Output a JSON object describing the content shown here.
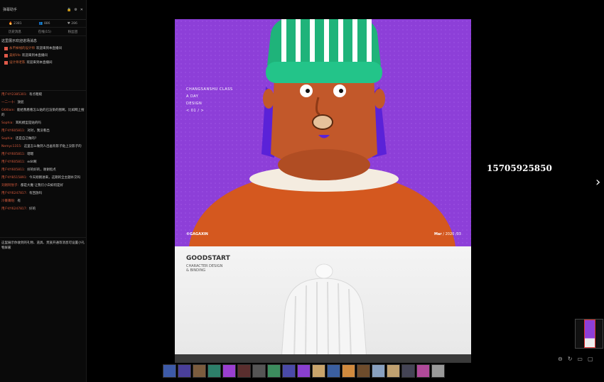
{
  "panel": {
    "title": "弹幕助手",
    "stats": [
      {
        "icon": "flame-icon",
        "value": "2381"
      },
      {
        "icon": "people-icon",
        "value": "886"
      },
      {
        "icon": "heart-icon",
        "value": "286"
      }
    ],
    "tabs": [
      "历史消息",
      "在线(15)",
      "粉丝团"
    ],
    "notice": "这里展示欢迎进场消息",
    "system_messages": [
      {
        "user": "永不掉线的设计师",
        "text": "欢迎来到本直播间"
      },
      {
        "user": "美好life",
        "text": "欢迎来到本直播间"
      },
      {
        "user": "设计师老陈",
        "text": "欢迎来到本直播间"
      }
    ],
    "chat": [
      {
        "user": "用户4Y2385301:",
        "text": "有点粗糙"
      },
      {
        "user": "一二一十:",
        "text": "放屁"
      },
      {
        "user": "GKKlain:",
        "text": "能给我看看怎么贴的已渲染的图啊，比如网上搜的"
      },
      {
        "user": "Sophia:",
        "text": "耳机模型是贴的吗"
      },
      {
        "user": "用户4Y605811:",
        "text": "对对，我没看出"
      },
      {
        "user": "Sophia:",
        "text": "还是自己做的?"
      },
      {
        "user": "Nemyc1315:",
        "text": "这里怎么做到人出画有影子贴上没影子的"
      },
      {
        "user": "用户4Y605811:",
        "text": "嗯嗯"
      },
      {
        "user": "用户4Y605811:",
        "text": "edit啊"
      },
      {
        "user": "用户4Y605811:",
        "text": "好的好的，谢谢指点"
      },
      {
        "user": "用户4Y8515891:",
        "text": "今天刚刚进来，这期的全主题补交吗"
      },
      {
        "user": "刘刚阿悦子:",
        "text": "都是大魔 让我们小白如何是好"
      },
      {
        "user": "用户4Y6247817:",
        "text": "有回放吗"
      },
      {
        "user": "冷箐箐呢:",
        "text": "有"
      },
      {
        "user": "用户4Y6247817:",
        "text": "好的"
      }
    ],
    "footer": "这里展示你收到的礼物、道具、贵族开通等消息可设置小礼物屏蔽"
  },
  "poster": {
    "title_lines": [
      "CHANGSANSHU CLASS",
      "A DAY",
      "DESIGN",
      "< 01 / >"
    ],
    "copyright": "©GAGAXIN",
    "date_bold": "Mar",
    "date_rest": " / 2020 /03",
    "lower_title": "GOODSTART",
    "lower_sub": [
      "CHARACTER DESIGN",
      "& BINDING"
    ]
  },
  "phone": "15705925850",
  "thumbs": [
    "#3d5aa8",
    "#4a3f9a",
    "#7b5c3e",
    "#2d7f6a",
    "#9a3fd0",
    "#5a2e2e",
    "#555",
    "#3c8c5e",
    "#4a4aa8",
    "#8a3fd0",
    "#c9a46b",
    "#3b5fa0",
    "#d08a3e",
    "#6e4c2c",
    "#88a0c0",
    "#bfa070",
    "#445",
    "#b04a9a",
    "#999"
  ],
  "tools": [
    "zoom-out-icon",
    "rotate-icon",
    "fit-icon",
    "window-icon"
  ]
}
